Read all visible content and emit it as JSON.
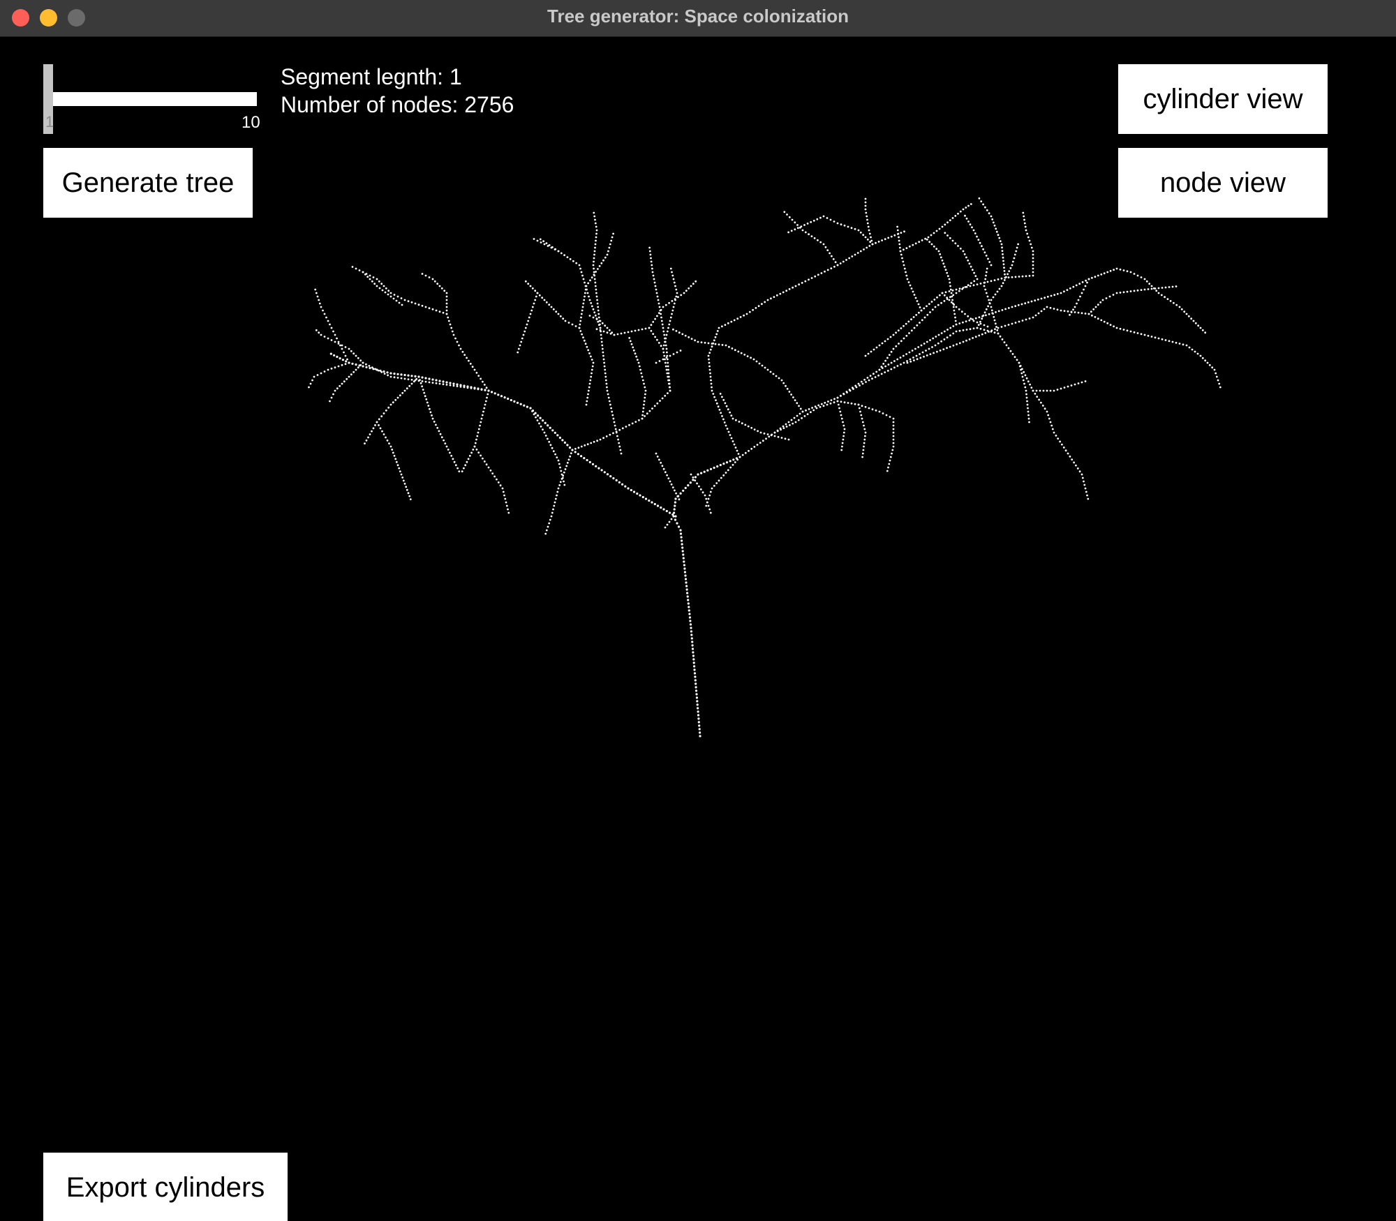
{
  "window": {
    "title": "Tree generator: Space colonization"
  },
  "slider": {
    "min_label": "1",
    "max_label": "10",
    "value": 1
  },
  "info": {
    "segment_length": "Segment legnth: 1",
    "node_count": "Number of nodes: 2756"
  },
  "buttons": {
    "generate": "Generate tree",
    "cylinder_view": "cylinder view",
    "node_view": "node view",
    "export": "Export cylinders"
  },
  "colors": {
    "background": "#000000",
    "button": "#ffffff",
    "tree_nodes": "#ffffff"
  }
}
